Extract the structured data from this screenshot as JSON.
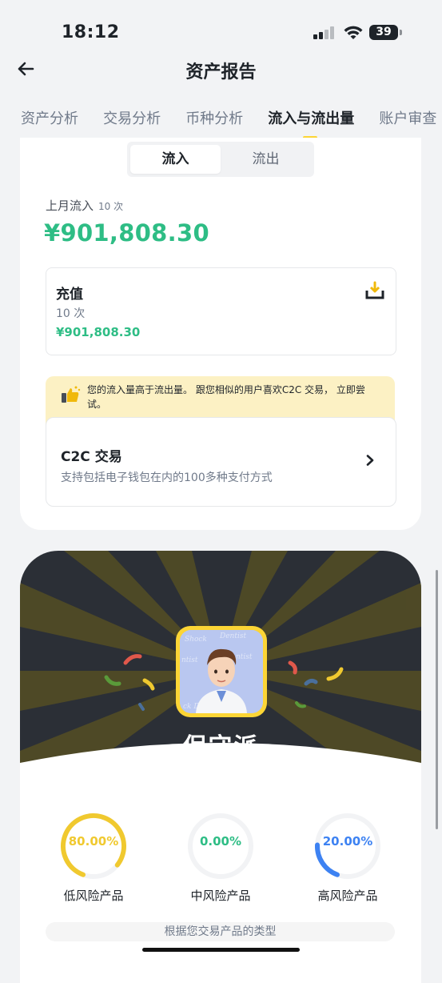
{
  "status_bar": {
    "time": "18:12",
    "battery": "39"
  },
  "header": {
    "title": "资产报告"
  },
  "tabs": [
    {
      "label": "资产分析"
    },
    {
      "label": "交易分析"
    },
    {
      "label": "币种分析"
    },
    {
      "label": "流入与流出量",
      "active": true
    },
    {
      "label": "账户审查"
    }
  ],
  "segment": {
    "inflow": "流入",
    "outflow": "流出"
  },
  "summary": {
    "label": "上月流入",
    "count": "10 次",
    "amount": "¥901,808.30"
  },
  "deposit": {
    "title": "充值",
    "count": "10 次",
    "amount": "¥901,808.30",
    "icon": "download-tray-icon"
  },
  "tip": {
    "text": "您的流入量高于流出量。 跟您相似的用户喜欢C2C 交易， 立即尝试。"
  },
  "c2c": {
    "title": "C2C 交易",
    "description": "支持包括电子钱包在内的100多种支付方式"
  },
  "persona": {
    "name": "保守派",
    "avatar_text": "Shock Dentist"
  },
  "risk": [
    {
      "value": "80.00%",
      "fraction": 0.8,
      "label": "低风险产品",
      "color": "#f0c92f"
    },
    {
      "value": "0.00%",
      "fraction": 0.0,
      "label": "中风险产品",
      "color": "#2ebd85"
    },
    {
      "value": "20.00%",
      "fraction": 0.2,
      "label": "高风险产品",
      "color": "#3d82f2"
    }
  ],
  "footnote": "根据您交易产品的类型",
  "colors": {
    "accent": "#fcd535",
    "positive": "#2ebd85",
    "dark_bg": "#2b2f36"
  }
}
